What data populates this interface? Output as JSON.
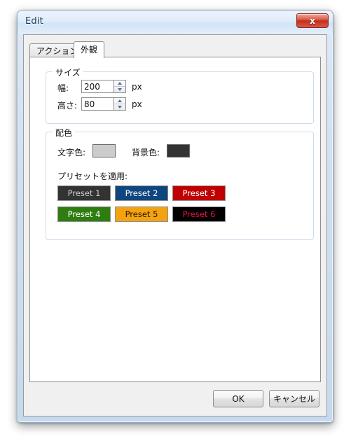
{
  "window": {
    "title": "Edit",
    "close_icon": "close-icon",
    "close_label": "x"
  },
  "tabs": [
    {
      "label": "アクション",
      "active": false
    },
    {
      "label": "外観",
      "active": true
    }
  ],
  "size_group": {
    "legend": "サイズ",
    "fields": [
      {
        "label": "幅:",
        "value": "200",
        "unit": "px"
      },
      {
        "label": "高さ:",
        "value": "80",
        "unit": "px"
      }
    ]
  },
  "color_group": {
    "legend": "配色",
    "text_color_label": "文字色:",
    "text_color_value": "#cccccc",
    "bg_color_label": "背景色:",
    "bg_color_value": "#333333",
    "preset_label": "プリセットを適用:",
    "presets": [
      {
        "label": "Preset 1",
        "bg": "#333333",
        "fg": "#cccccc"
      },
      {
        "label": "Preset 2",
        "bg": "#10467f",
        "fg": "#ffffff"
      },
      {
        "label": "Preset 3",
        "bg": "#c00000",
        "fg": "#ffffff"
      },
      {
        "label": "Preset 4",
        "bg": "#2e7d10",
        "fg": "#ffffff"
      },
      {
        "label": "Preset 5",
        "bg": "#f5a210",
        "fg": "#231a00"
      },
      {
        "label": "Preset 6",
        "bg": "#000000",
        "fg": "#e8123f"
      }
    ]
  },
  "footer": {
    "ok_label": "OK",
    "cancel_label": "キャンセル"
  }
}
